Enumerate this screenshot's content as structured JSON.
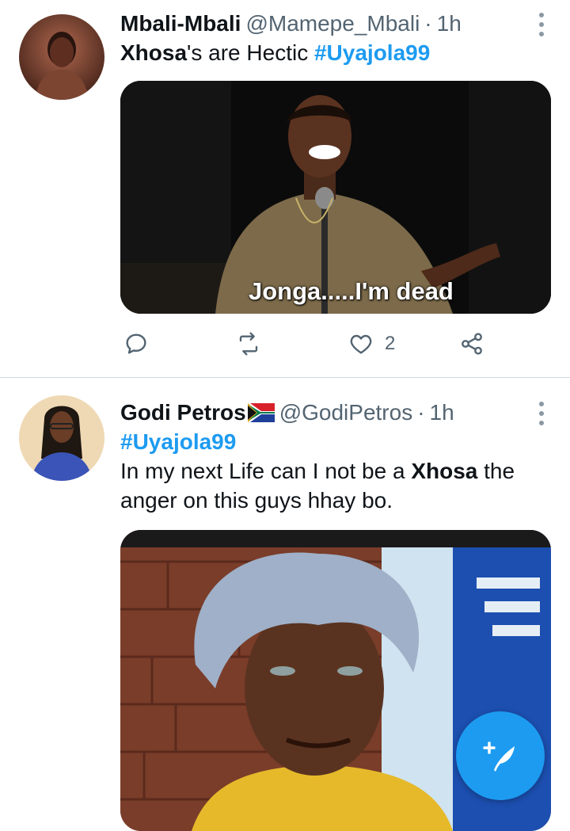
{
  "tweets": [
    {
      "display_name": "Mbali-Mbali",
      "handle": "@Mamepe_Mbali",
      "separator": "·",
      "time": "1h",
      "text_bold": "Xhosa",
      "text_rest": "'s are Hectic ",
      "hashtag": "#Uyajola99",
      "media_caption": "Jonga.....I'm dead",
      "actions": {
        "reply_count": "",
        "retweet_count": "",
        "like_count": "2"
      }
    },
    {
      "display_name": "Godi Petros",
      "flag_icon": "south-africa-flag-icon",
      "handle": "@GodiPetros",
      "separator": "·",
      "time": "1h",
      "hashtag": "#Uyajola99",
      "text_before": "In my next Life can I not be a ",
      "text_bold": "Xhosa",
      "text_after": " the anger on this guys hhay bo."
    }
  ],
  "colors": {
    "accent": "#1d9bf0",
    "secondary_text": "#536471",
    "divider": "#cfd9de"
  },
  "fab": {
    "icon": "compose-tweet-icon"
  }
}
